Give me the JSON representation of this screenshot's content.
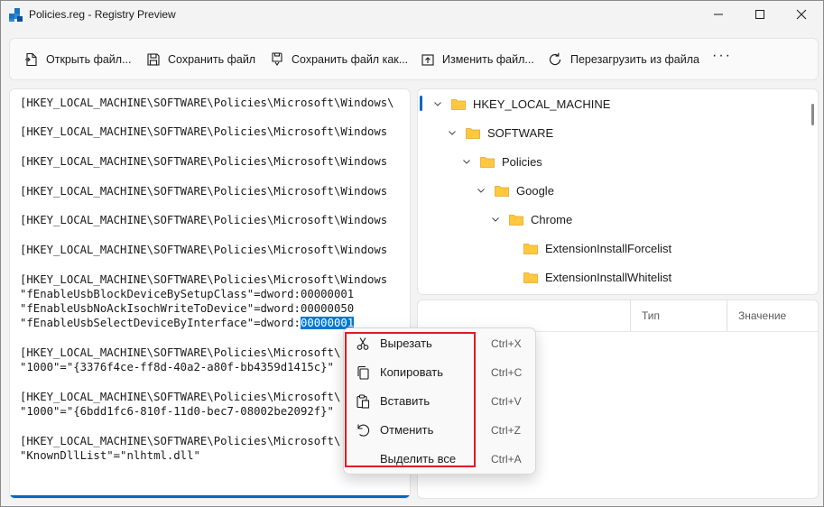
{
  "window": {
    "title": "Policies.reg - Registry Preview"
  },
  "toolbar": {
    "open_label": "Открыть файл...",
    "save_label": "Сохранить файл",
    "save_as_label": "Сохранить файл как...",
    "edit_label": "Изменить файл...",
    "reload_label": "Перезагрузить из файла",
    "more_label": "···"
  },
  "editor": {
    "lines": [
      "[HKEY_LOCAL_MACHINE\\SOFTWARE\\Policies\\Microsoft\\Windows\\",
      "[HKEY_LOCAL_MACHINE\\SOFTWARE\\Policies\\Microsoft\\Windows",
      "[HKEY_LOCAL_MACHINE\\SOFTWARE\\Policies\\Microsoft\\Windows",
      "[HKEY_LOCAL_MACHINE\\SOFTWARE\\Policies\\Microsoft\\Windows",
      "[HKEY_LOCAL_MACHINE\\SOFTWARE\\Policies\\Microsoft\\Windows",
      "[HKEY_LOCAL_MACHINE\\SOFTWARE\\Policies\\Microsoft\\Windows",
      "[HKEY_LOCAL_MACHINE\\SOFTWARE\\Policies\\Microsoft\\Windows",
      "\"fEnableUsbBlockDeviceBySetupClass\"=dword:00000001",
      "\"fEnableUsbNoAckIsochWriteToDevice\"=dword:00000050",
      "\"fEnableUsbSelectDeviceByInterface\"=dword:",
      "[HKEY_LOCAL_MACHINE\\SOFTWARE\\Policies\\Microsoft\\",
      "\"1000\"=\"{3376f4ce-ff8d-40a2-a80f-bb4359d1415c}\"",
      "[HKEY_LOCAL_MACHINE\\SOFTWARE\\Policies\\Microsoft\\",
      "\"1000\"=\"{6bdd1fc6-810f-11d0-bec7-08002be2092f}\"",
      "[HKEY_LOCAL_MACHINE\\SOFTWARE\\Policies\\Microsoft\\",
      "\"KnownDllList\"=\"nlhtml.dll\""
    ],
    "selected_text": "00000001"
  },
  "tree": {
    "items": [
      {
        "label": "HKEY_LOCAL_MACHINE"
      },
      {
        "label": "SOFTWARE"
      },
      {
        "label": "Policies"
      },
      {
        "label": "Google"
      },
      {
        "label": "Chrome"
      },
      {
        "label": "ExtensionInstallForcelist"
      },
      {
        "label": "ExtensionInstallWhitelist"
      }
    ]
  },
  "values_table": {
    "columns": [
      "",
      "Тип",
      "Значение"
    ]
  },
  "context_menu": {
    "items": [
      {
        "label": "Вырезать",
        "shortcut": "Ctrl+X",
        "icon": "cut-icon"
      },
      {
        "label": "Копировать",
        "shortcut": "Ctrl+C",
        "icon": "copy-icon"
      },
      {
        "label": "Вставить",
        "shortcut": "Ctrl+V",
        "icon": "paste-icon"
      },
      {
        "label": "Отменить",
        "shortcut": "Ctrl+Z",
        "icon": "undo-icon"
      },
      {
        "label": "Выделить все",
        "shortcut": "Ctrl+A",
        "icon": ""
      }
    ]
  },
  "colors": {
    "accent": "#0067c0",
    "selection": "#0078d4",
    "folder": "#ffc83d",
    "annotation": "#e01a22"
  }
}
